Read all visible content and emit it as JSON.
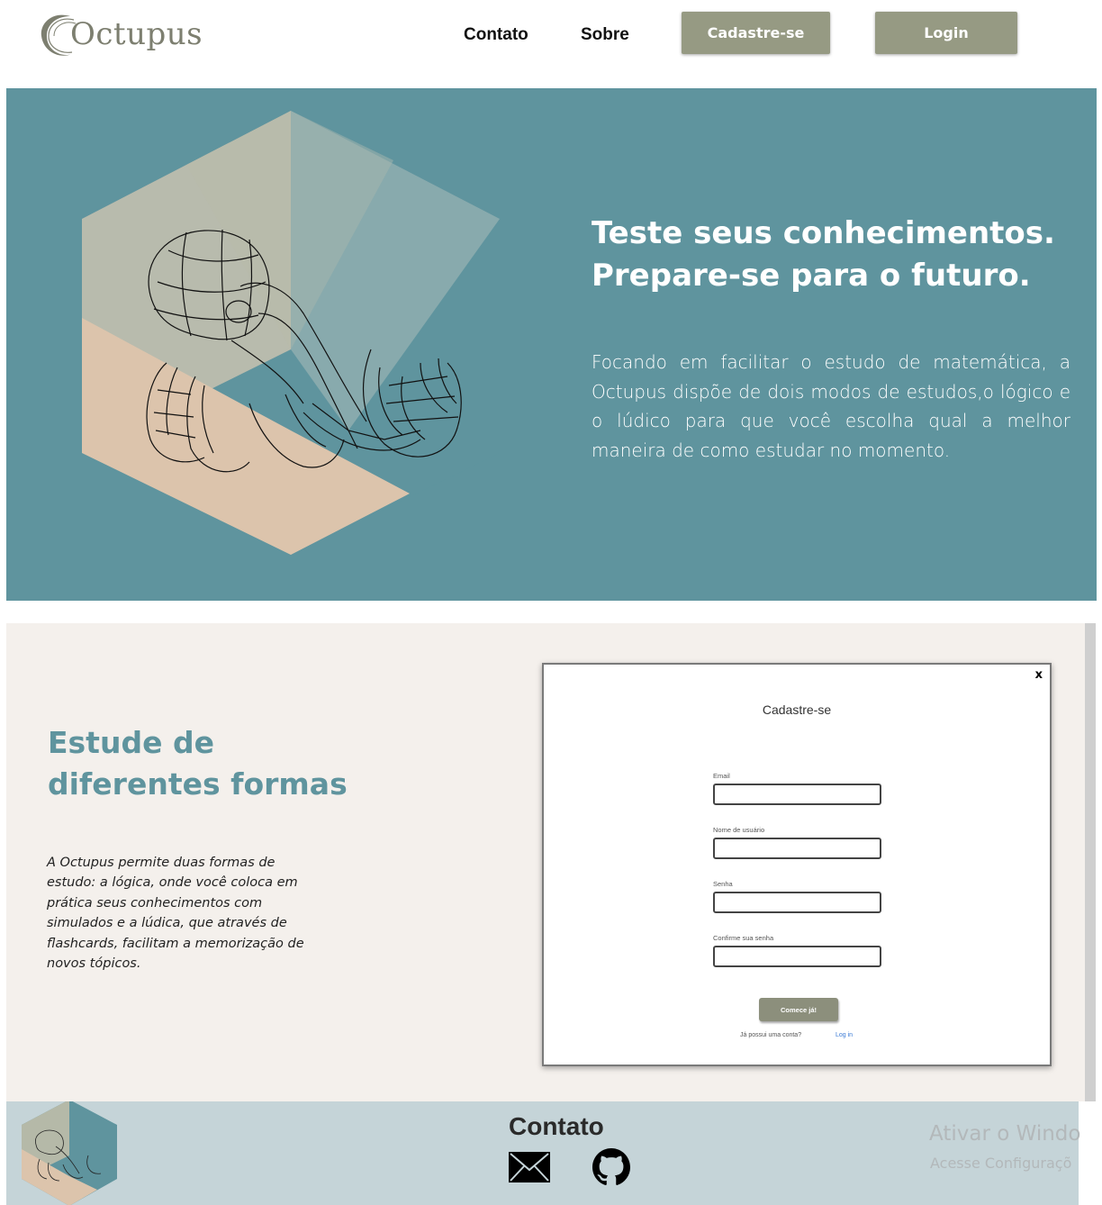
{
  "nav": {
    "logo_text": "Octupus",
    "links": [
      "Contato",
      "Sobre"
    ],
    "signup_label": "Cadastre-se",
    "login_label": "Login",
    "button_color": "#969a83"
  },
  "hero": {
    "title_line1": "Teste seus conhecimentos.",
    "title_line2": "Prepare-se para o futuro.",
    "text": "Focando em facilitar o estudo de matemática, a Octupus dispõe de dois modos de estudos,o lógico e o lúdico para que você escolha qual a melhor maneira de como estudar no momento.",
    "background": "#5f949e"
  },
  "study": {
    "title_line1": "Estude de",
    "title_line2": "diferentes formas",
    "text": "A Octupus permite duas formas de estudo: a lógica, onde você coloca em prática seus conhecimentos com simulados e a lúdica, que através de flashcards, facilitam a memorização de novos tópicos.",
    "background": "#f4f0ec"
  },
  "modal": {
    "close": "x",
    "title": "Cadastre-se",
    "fields": [
      {
        "label": "Email",
        "value": ""
      },
      {
        "label": "Nome de usuário",
        "value": ""
      },
      {
        "label": "Senha",
        "value": ""
      },
      {
        "label": "Confirme sua senha",
        "value": ""
      }
    ],
    "submit_label": "Comece já!",
    "login_question": "Já possui uma conta?",
    "login_link": "Log in"
  },
  "footer": {
    "title": "Contato",
    "icons": [
      "mail-icon",
      "github-icon"
    ],
    "background": "#c5d4d8"
  },
  "watermark": {
    "line1": "Ativar o Windo",
    "line2": "Acesse Configuraçõ"
  }
}
